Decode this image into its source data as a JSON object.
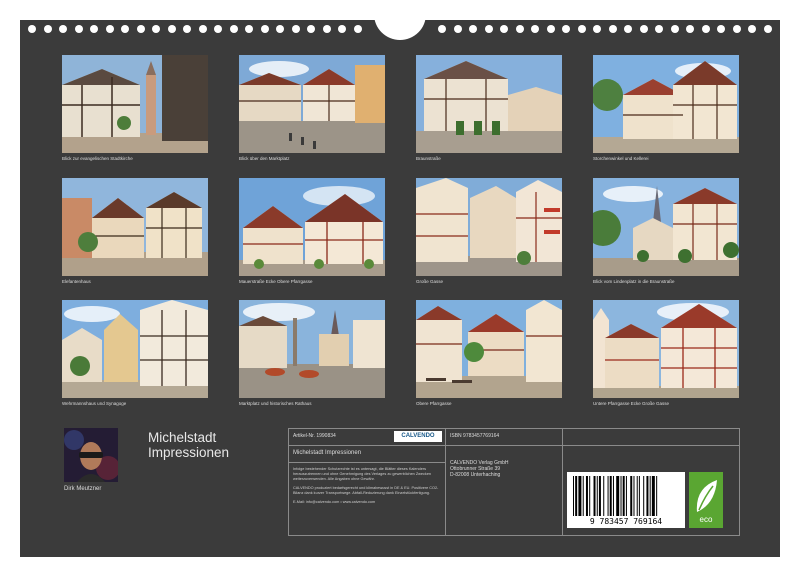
{
  "photos": [
    {
      "caption": "Blick zur evangelischen Stadtkirche"
    },
    {
      "caption": "Blick über den Marktplatz"
    },
    {
      "caption": "Braunstraße"
    },
    {
      "caption": "Storchenwinkel und Kellerei"
    },
    {
      "caption": "Elefantenhaus"
    },
    {
      "caption": "Mauerstraße Ecke Obere Pfarrgasse"
    },
    {
      "caption": "Große Gasse"
    },
    {
      "caption": "Blick vom Lindenplatz in die Braunstraße"
    },
    {
      "caption": "Wehrmannshaus und Synagoge"
    },
    {
      "caption": "Marktplatz und historisches Rathaus"
    },
    {
      "caption": "Obere Pfarrgasse"
    },
    {
      "caption": "Untere Pfarrgasse Ecke Große Gasse"
    }
  ],
  "author": "Dirk Meutzner",
  "title_line1": "Michelstadt",
  "title_line2": "Impressionen",
  "info": {
    "article_no": "Artikel-Nr. 1990834",
    "calvendo_logo": "CALVENDO",
    "product_title": "Michelstadt Impressionen",
    "copyright_text": "Infolge bestehender Schutzrechte ist es untersagt, die Blätter dieses Kalenders herauszutrennen und ohne Genehmigung des Verlages zu gewerblichen Zwecken weiterzuverwenden. Alle Angaben ohne Gewähr.",
    "production_text": "CALVENDO produziert bedarfsgerecht und klimabewusst in DE & EU. Positivere CO2-Bilanz dank kurzer Transportwege. Abfall-Reduzierung dank Einzelstückfertigung.",
    "contact": "E-Mail: info@calvendo.com • www.calvendo.com",
    "isbn": "ISBN 9783457769164",
    "publisher_name": "CALVENDO Verlag GmbH",
    "publisher_street": "Ottobrunner Straße 39",
    "publisher_city": "D-82008 Unterhaching",
    "barcode_digits": "9 783457 769164",
    "eco_label": "eco"
  },
  "colors": {
    "page_background": "#3b3b3b",
    "eco_green": "#5aa632"
  }
}
